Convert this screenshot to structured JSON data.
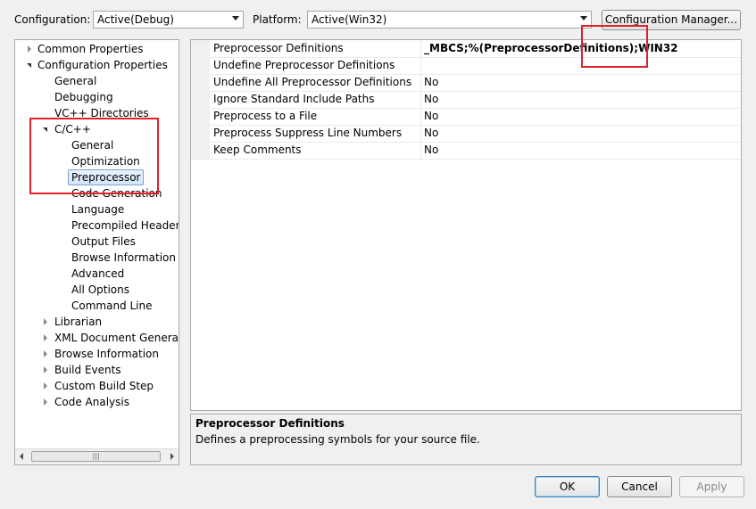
{
  "toolbar": {
    "configuration_label": "Configuration:",
    "configuration_value": "Active(Debug)",
    "platform_label": "Platform:",
    "platform_value": "Active(Win32)",
    "config_manager_label": "Configuration Manager..."
  },
  "tree": {
    "common_properties": "Common Properties",
    "configuration_properties": "Configuration Properties",
    "general": "General",
    "debugging": "Debugging",
    "vc_directories": "VC++ Directories",
    "cpp": "C/C++",
    "cpp_general": "General",
    "cpp_optimization": "Optimization",
    "cpp_preprocessor": "Preprocessor",
    "cpp_code_generation": "Code Generation",
    "cpp_language": "Language",
    "cpp_precompiled_headers": "Precompiled Headers",
    "cpp_output_files": "Output Files",
    "cpp_browse_information": "Browse Information",
    "cpp_advanced": "Advanced",
    "cpp_all_options": "All Options",
    "cpp_command_line": "Command Line",
    "librarian": "Librarian",
    "xml_doc_generator": "XML Document Generator",
    "browse_information": "Browse Information",
    "build_events": "Build Events",
    "custom_build_step": "Custom Build Step",
    "code_analysis": "Code Analysis"
  },
  "grid": {
    "rows": [
      {
        "name": "Preprocessor Definitions",
        "value": "_MBCS;%(PreprocessorDefinitions);WIN32"
      },
      {
        "name": "Undefine Preprocessor Definitions",
        "value": ""
      },
      {
        "name": "Undefine All Preprocessor Definitions",
        "value": "No"
      },
      {
        "name": "Ignore Standard Include Paths",
        "value": "No"
      },
      {
        "name": "Preprocess to a File",
        "value": "No"
      },
      {
        "name": "Preprocess Suppress Line Numbers",
        "value": "No"
      },
      {
        "name": "Keep Comments",
        "value": "No"
      }
    ]
  },
  "description": {
    "title": "Preprocessor Definitions",
    "text": "Defines a preprocessing symbols for your source file."
  },
  "buttons": {
    "ok": "OK",
    "cancel": "Cancel",
    "apply": "Apply"
  },
  "colors": {
    "highlight_box": "#e0202a",
    "selection_border": "#7da2ce"
  }
}
